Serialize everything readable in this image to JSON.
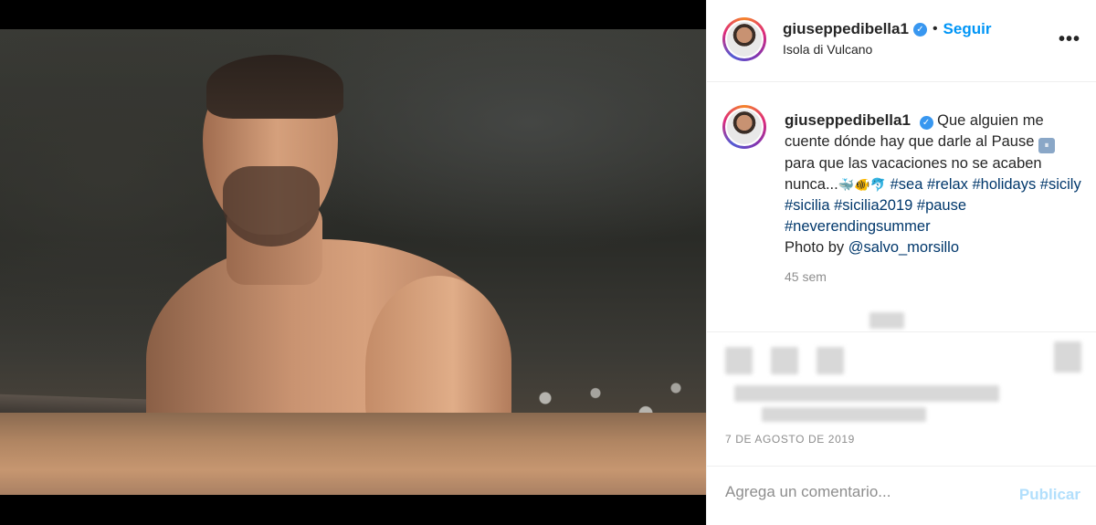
{
  "post": {
    "username": "giuseppedibella1",
    "verified_mark": "✓",
    "separator": "•",
    "follow_label": "Seguir",
    "location": "Isola di Vulcano",
    "more_label": "•••"
  },
  "caption": {
    "username": "giuseppedibella1",
    "text_1": "Que alguien me cuente dónde hay que darle al Pause",
    "pause_symbol": "⏸",
    "text_2": "para que las vacaciones no se acaben nunca...",
    "emojis": "🐳🐠🐬",
    "hashtags": "#sea #relax #holidays #sicily #sicilia #sicilia2019 #pause #neverendingsummer",
    "credit_prefix": "Photo by",
    "credit_handle": "@salvo_morsillo",
    "age": "45 sem"
  },
  "meta": {
    "date": "7 DE AGOSTO DE 2019"
  },
  "comment": {
    "placeholder": "Agrega un comentario...",
    "publish_label": "Publicar"
  },
  "colors": {
    "link_blue": "#0095f6",
    "verified_blue": "#3897f0",
    "hashtag": "#00376b",
    "muted": "#8e8e8e",
    "publish_disabled": "#b2dffc"
  }
}
